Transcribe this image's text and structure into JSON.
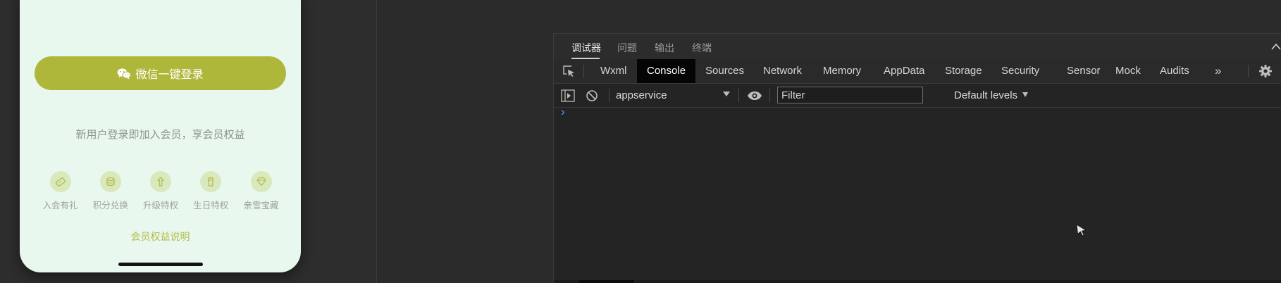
{
  "simulator": {
    "login_button_label": "微信一键登录",
    "promo_text": "新用户登录即加入会员，享会员权益",
    "benefits": [
      {
        "label": "入会有礼",
        "icon": "ticket-icon"
      },
      {
        "label": "积分兑换",
        "icon": "coin-stack-icon"
      },
      {
        "label": "升级特权",
        "icon": "upgrade-arrow-icon"
      },
      {
        "label": "生日特权",
        "icon": "gift-cup-icon"
      },
      {
        "label": "亲雪宝藏",
        "icon": "diamond-icon"
      }
    ],
    "rules_link": "会员权益说明",
    "colors": {
      "accent": "#afb73b",
      "page_bg": "#e9f8ee",
      "icon_bg": "#d9e9bd",
      "link": "#b3bb4a"
    }
  },
  "devtools": {
    "top_tabs": [
      {
        "label": "调试器",
        "active": true
      },
      {
        "label": "问题",
        "active": false
      },
      {
        "label": "输出",
        "active": false
      },
      {
        "label": "终端",
        "active": false
      }
    ],
    "tool_tabs": [
      {
        "label": "Wxml",
        "active": false
      },
      {
        "label": "Console",
        "active": true
      },
      {
        "label": "Sources",
        "active": false
      },
      {
        "label": "Network",
        "active": false
      },
      {
        "label": "Memory",
        "active": false
      },
      {
        "label": "AppData",
        "active": false
      },
      {
        "label": "Storage",
        "active": false
      },
      {
        "label": "Security",
        "active": false
      },
      {
        "label": "Sensor",
        "active": false
      },
      {
        "label": "Mock",
        "active": false
      },
      {
        "label": "Audits",
        "active": false
      }
    ],
    "more_tabs_glyph": "»",
    "console": {
      "context": "appservice",
      "filter_placeholder": "Filter",
      "filter_value": "",
      "levels": "Default levels",
      "prompt_glyph": "›"
    },
    "colors": {
      "bg": "#242424",
      "active_tab_bg": "#050505",
      "prompt": "#4aa3ff"
    }
  }
}
